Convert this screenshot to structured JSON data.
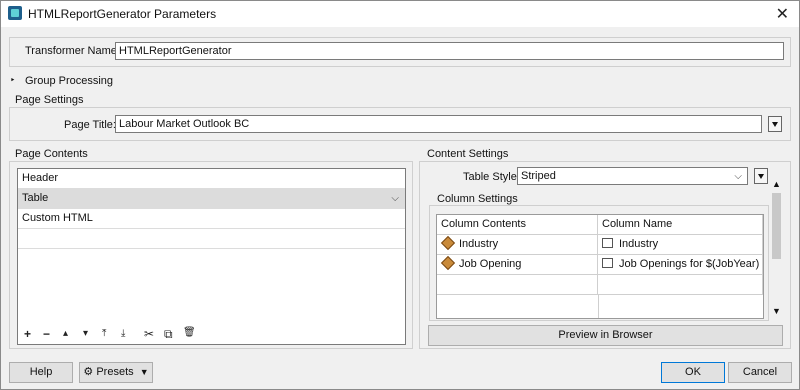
{
  "window": {
    "title": "HTMLReportGenerator Parameters",
    "close_glyph": "✕"
  },
  "transformer": {
    "label": "Transformer Name:",
    "value": "HTMLReportGenerator"
  },
  "group_processing": {
    "label": "Group Processing",
    "marker": "‣"
  },
  "page_settings": {
    "label": "Page Settings",
    "page_title_label": "Page Title:",
    "page_title_value": "Labour Market Outlook BC"
  },
  "page_contents": {
    "label": "Page Contents",
    "items": [
      "Header",
      "Table",
      "Custom HTML"
    ],
    "selected_index": 1,
    "toolbar": [
      "+",
      "−",
      "▴",
      "▾",
      "⤒",
      "⤓",
      "✂",
      "⧉",
      "🗑"
    ]
  },
  "content_settings": {
    "label": "Content Settings",
    "table_style_label": "Table Style:",
    "table_style_value": "Striped",
    "column_settings": {
      "label": "Column Settings",
      "headers": [
        "Column Contents",
        "Column Name"
      ],
      "rows": [
        {
          "contents": "Industry",
          "name": "Industry"
        },
        {
          "contents": "Job Opening",
          "name": "Job Openings for $(JobYear)"
        }
      ]
    },
    "preview_button": "Preview in Browser"
  },
  "footer": {
    "help": "Help",
    "presets": "Presets",
    "ok": "OK",
    "cancel": "Cancel"
  },
  "colors": {
    "selection": "#dcdcdc",
    "accent": "#0078d7",
    "attr_icon": "#c98a3a"
  },
  "icons": [
    "app-icon",
    "close-icon",
    "dropdown-icon",
    "attribute-icon",
    "text-icon",
    "gear-icon"
  ]
}
